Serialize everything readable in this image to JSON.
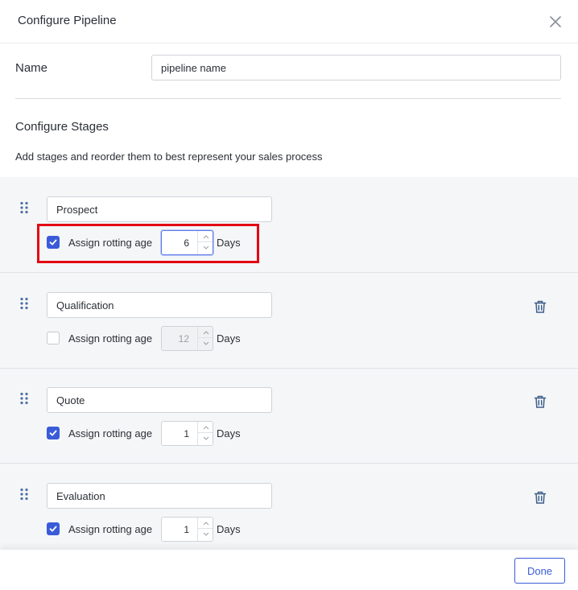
{
  "dialog": {
    "title": "Configure Pipeline"
  },
  "name_field": {
    "label": "Name",
    "value": "pipeline name"
  },
  "configure_stages": {
    "title": "Configure Stages",
    "description": "Add stages and reorder them to best represent your sales process"
  },
  "stages": [
    {
      "name": "Prospect",
      "assign_label": "Assign rotting age",
      "checked": true,
      "age": "6",
      "days_label": "Days",
      "deletable": false
    },
    {
      "name": "Qualification",
      "assign_label": "Assign rotting age",
      "checked": false,
      "age": "12",
      "days_label": "Days",
      "deletable": true
    },
    {
      "name": "Quote",
      "assign_label": "Assign rotting age",
      "checked": true,
      "age": "1",
      "days_label": "Days",
      "deletable": true
    },
    {
      "name": "Evaluation",
      "assign_label": "Assign rotting age",
      "checked": true,
      "age": "1",
      "days_label": "Days",
      "deletable": true
    }
  ],
  "footer": {
    "done_label": "Done"
  },
  "colors": {
    "accent": "#3a5bd9",
    "highlight": "#e30613",
    "stage_bg": "#f5f6f7"
  },
  "icons": {
    "close": "close-icon",
    "drag": "drag-handle-icon",
    "check": "checkmark-icon",
    "trash": "trash-icon",
    "spin_up": "chevron-up-icon",
    "spin_down": "chevron-down-icon"
  }
}
